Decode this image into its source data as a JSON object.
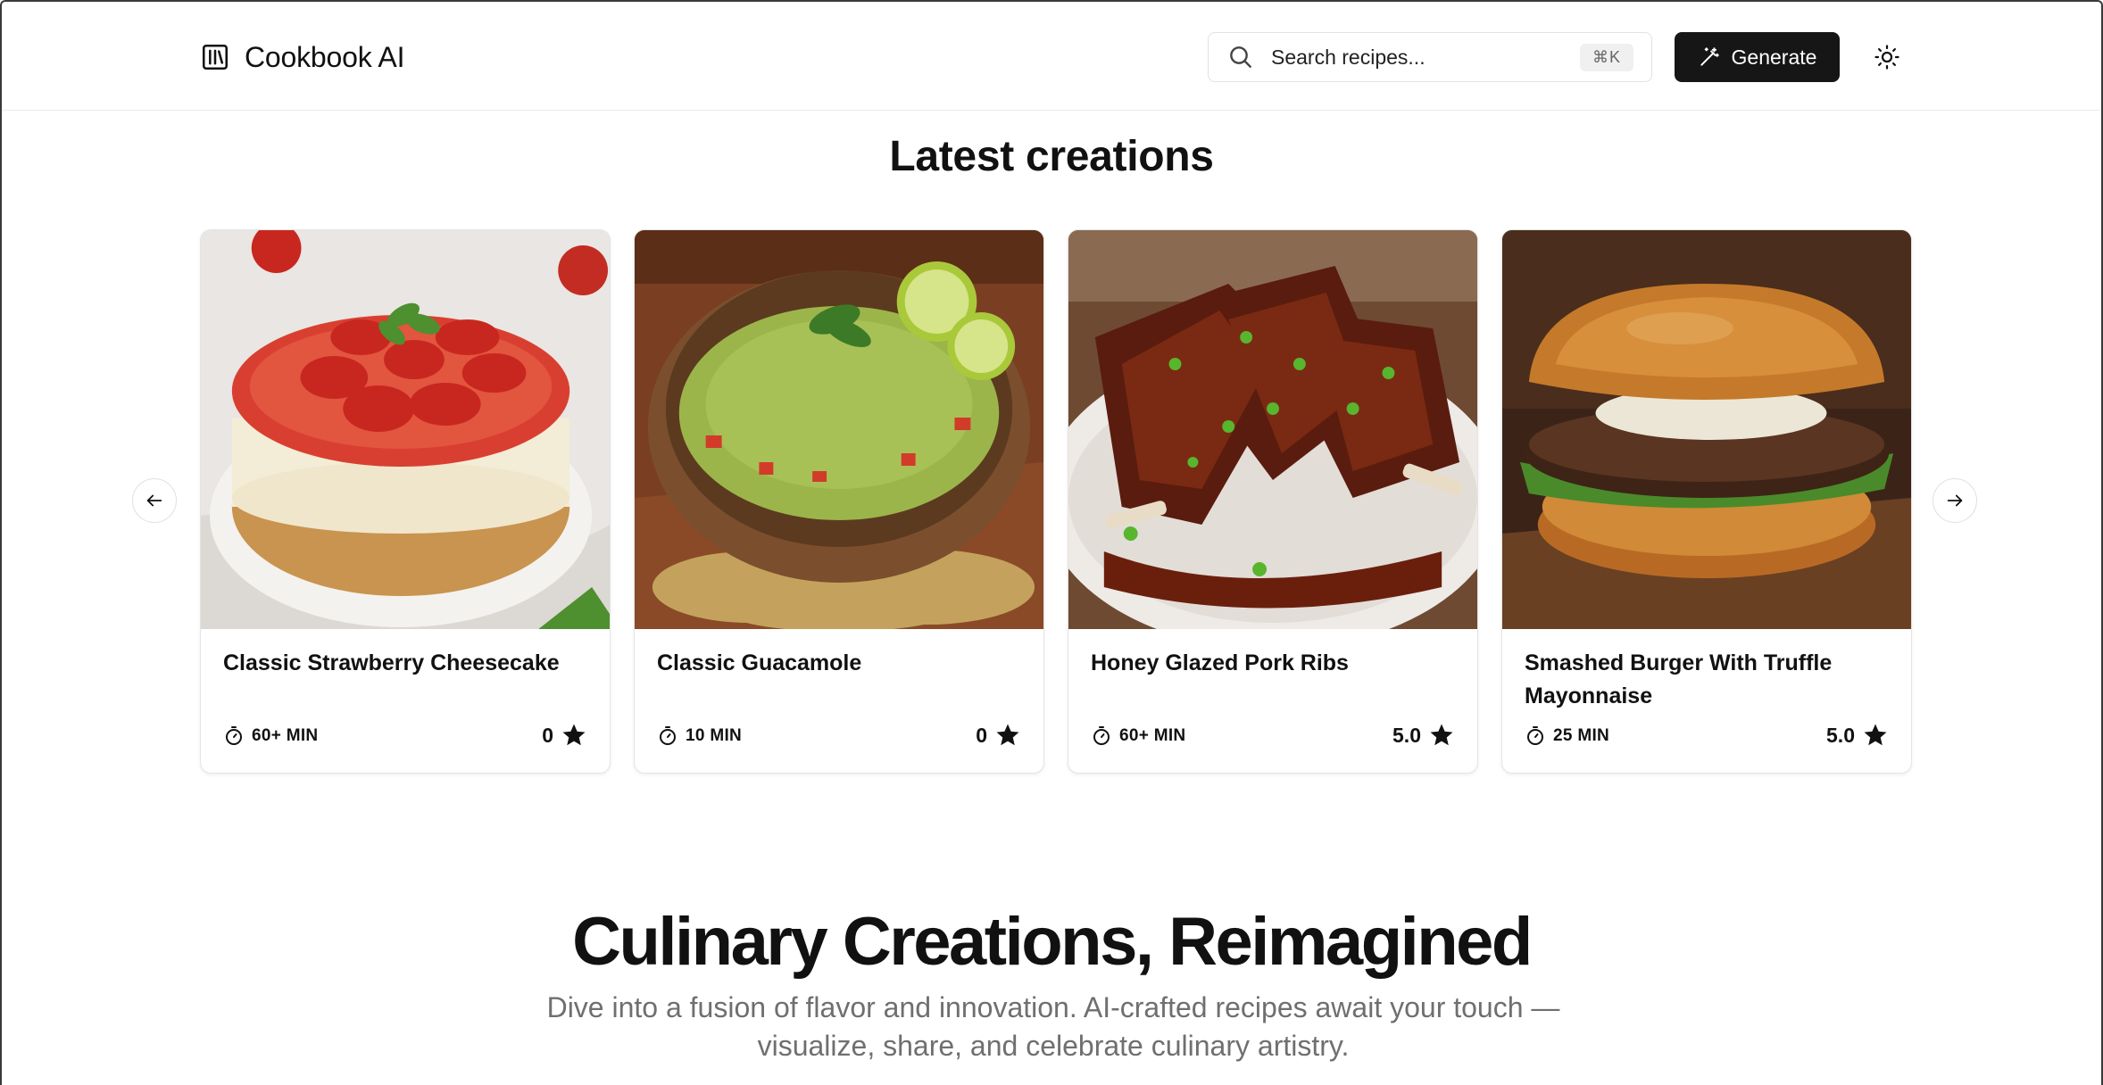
{
  "header": {
    "brand_name": "Cookbook AI",
    "search_placeholder": "Search recipes...",
    "search_shortcut": "⌘K",
    "generate_label": "Generate"
  },
  "section": {
    "title": "Latest creations"
  },
  "cards": [
    {
      "title": "Classic Strawberry Cheesecake",
      "time": "60+ MIN",
      "rating": "0",
      "image": "strawberry-cheesecake"
    },
    {
      "title": "Classic Guacamole",
      "time": "10 MIN",
      "rating": "0",
      "image": "guacamole"
    },
    {
      "title": "Honey Glazed Pork Ribs",
      "time": "60+ MIN",
      "rating": "5.0",
      "image": "pork-ribs"
    },
    {
      "title": "Smashed Burger With Truffle Mayonnaise",
      "time": "25 MIN",
      "rating": "5.0",
      "image": "burger"
    }
  ],
  "hero": {
    "title": "Culinary Creations, Reimagined",
    "subtitle": "Dive into a fusion of flavor and innovation. AI-crafted recipes await your touch —visualize, share, and celebrate culinary artistry."
  },
  "icons": {
    "brand": "library-icon",
    "search": "search-icon",
    "generate": "magic-wand-icon",
    "theme": "sun-icon",
    "time": "timer-icon",
    "rating": "star-icon",
    "prev": "arrow-left-icon",
    "next": "arrow-right-icon"
  }
}
